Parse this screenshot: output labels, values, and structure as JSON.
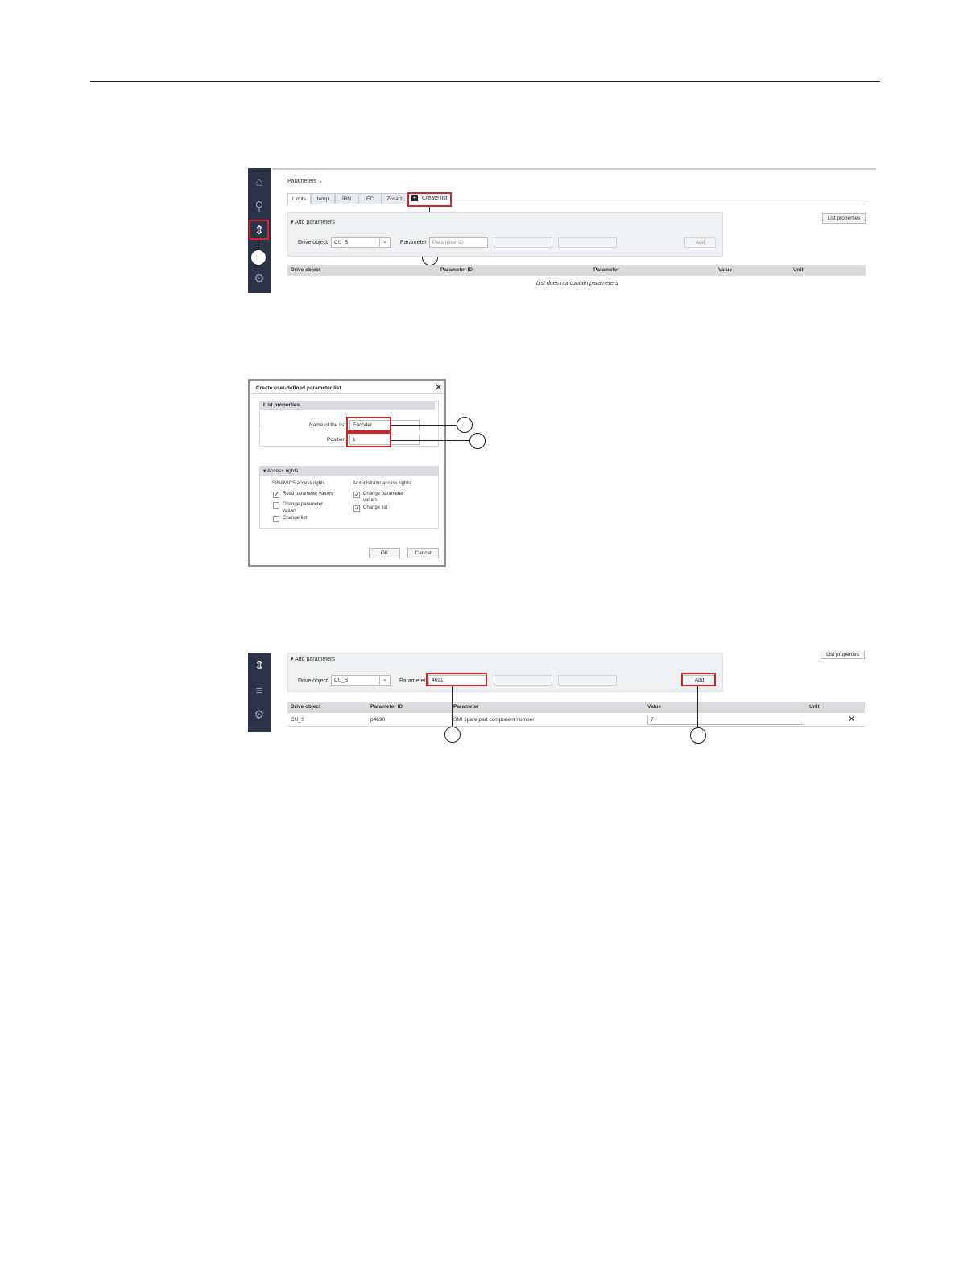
{
  "screen1": {
    "breadcrumb": "Parameters",
    "tabs": [
      "Limits",
      "temp",
      "IBN",
      "EC",
      "Zusatz"
    ],
    "create_list": "Create list",
    "list_properties": "List properties",
    "add_parameters": "Add parameters",
    "drive_object_label": "Drive object",
    "drive_object_value": "CU_S",
    "parameter_label": "Parameter",
    "parameter_placeholder": "Parameter ID",
    "add_button": "Add",
    "table_headers": [
      "Drive object",
      "Parameter ID",
      "Parameter",
      "Value",
      "Unit"
    ],
    "empty_message": "List does not contain parameters"
  },
  "dialog": {
    "title": "Create user-defined parameter list",
    "list_properties": "List properties",
    "name_label": "Name of the list",
    "name_value": "Encoder",
    "position_label": "Position",
    "position_value": "1",
    "access_rights": "Access rights",
    "sinamics_header": "SINAMICS access rights",
    "admin_header": "Administrator access rights",
    "sinamics_items": [
      {
        "label": "Read parameter values",
        "checked": true
      },
      {
        "label": "Change parameter values",
        "checked": false
      },
      {
        "label": "Change list",
        "checked": false
      }
    ],
    "admin_items": [
      {
        "label": "Change parameter values",
        "checked": true
      },
      {
        "label": "Change list",
        "checked": true
      }
    ],
    "ok": "OK",
    "cancel": "Cancel"
  },
  "screen3": {
    "list_properties": "List properties",
    "add_parameters": "Add parameters",
    "drive_object_label": "Drive object",
    "drive_object_value": "CU_S",
    "parameter_label": "Parameter",
    "parameter_value": "4691",
    "add_button": "Add",
    "table_headers": [
      "Drive object",
      "Parameter ID",
      "Parameter",
      "Value",
      "Unit"
    ],
    "row": {
      "drive_object": "CU_S",
      "parameter_id": "p4690",
      "parameter": "SMI spare part component number",
      "value": "7"
    }
  },
  "colors": {
    "sidebar": "#2b3347",
    "highlight": "#d0232a",
    "table_header": "#d9dbdf",
    "panel": "#eef0f2"
  }
}
